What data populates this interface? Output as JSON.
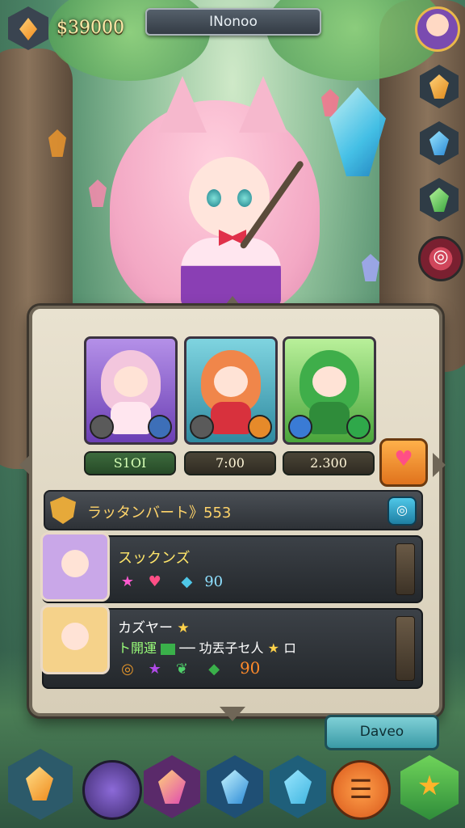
{
  "top_bar": {
    "currency": "$39000",
    "player_name": "INonoo"
  },
  "characters": [
    {
      "name": "pink-cat-girl",
      "stat": "S1OI",
      "accent": "#8a5bd6"
    },
    {
      "name": "orange-hair-girl",
      "stat": "7:00",
      "accent": "#3fa2b8"
    },
    {
      "name": "green-hair-girl",
      "stat": "2.300",
      "accent": "#5bbf3f"
    }
  ],
  "rank": {
    "label": "ラッタンバート》553"
  },
  "quests": [
    {
      "title": "スックンズ",
      "reward": "90"
    },
    {
      "title": "カズヤー",
      "subtitle": "ト開運",
      "subtitle_tail": "── 功丟子セ人",
      "subtitle_end": "ロ",
      "reward": "90"
    }
  ],
  "buttons": {
    "daveo": "Daveo"
  },
  "icons": {
    "heart": "♥",
    "star": "★",
    "diamond": "◆",
    "leaf": "❦",
    "globe": "◎",
    "hamburger": "☰"
  },
  "colors": {
    "gold": "#ffd46a",
    "panel": "#e9e2d0",
    "accent_teal": "#3a9aa6"
  }
}
